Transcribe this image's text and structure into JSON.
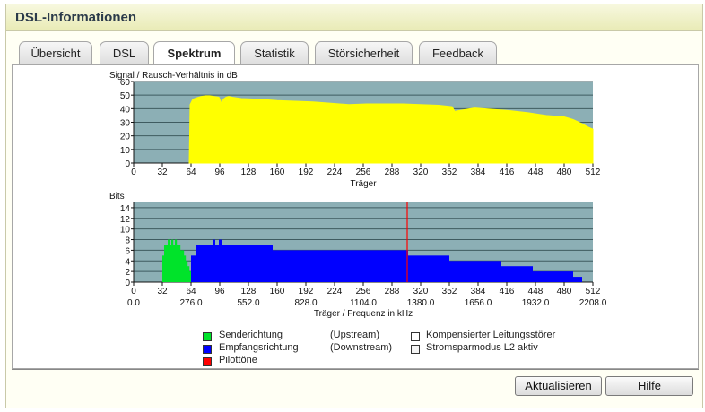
{
  "window": {
    "title": "DSL-Informationen"
  },
  "tabs": [
    {
      "label": "Übersicht",
      "active": false
    },
    {
      "label": "DSL",
      "active": false
    },
    {
      "label": "Spektrum",
      "active": true
    },
    {
      "label": "Statistik",
      "active": false
    },
    {
      "label": "Störsicherheit",
      "active": false
    },
    {
      "label": "Feedback",
      "active": false
    }
  ],
  "colors": {
    "plot_bg": "#8cafb5",
    "snr": "#ffff00",
    "upstream": "#00e32a",
    "downstream": "#0000ff",
    "pilot": "#ff0000"
  },
  "chart_data": [
    {
      "type": "area",
      "title": "Signal / Rausch-Verhältnis in dB",
      "xlabel": "Träger",
      "ylabel": "",
      "xlim": [
        0,
        512
      ],
      "ylim": [
        0,
        60
      ],
      "xticks": [
        0,
        32,
        64,
        96,
        128,
        160,
        192,
        224,
        256,
        288,
        320,
        352,
        384,
        416,
        448,
        480,
        512
      ],
      "yticks": [
        0,
        10,
        20,
        30,
        40,
        50,
        60
      ],
      "grid": true,
      "series": [
        {
          "x": [
            62,
            63,
            66,
            70,
            75,
            80,
            85,
            90,
            95,
            98,
            100,
            103,
            106,
            110,
            120,
            140,
            160,
            200,
            220,
            240,
            260,
            280,
            300,
            320,
            340,
            355,
            358,
            380,
            400,
            420,
            440,
            460,
            480,
            490,
            500,
            505,
            510,
            512
          ],
          "values": [
            0,
            43,
            47,
            48,
            49,
            49.5,
            49.5,
            49,
            48.5,
            44,
            47,
            48.5,
            49,
            48.5,
            47.5,
            47,
            46,
            45,
            44,
            43,
            43.5,
            43.5,
            43.5,
            43,
            42.5,
            41.5,
            38,
            40.5,
            39.5,
            38.5,
            37,
            35,
            34,
            32,
            29,
            27,
            25.5,
            25
          ]
        }
      ]
    },
    {
      "type": "bar",
      "title": "Bits",
      "xlabel": "Träger / Frequenz in kHz",
      "ylabel": "",
      "xlim": [
        0,
        512
      ],
      "ylim": [
        0,
        15
      ],
      "xticks": [
        0,
        32,
        64,
        96,
        128,
        160,
        192,
        224,
        256,
        288,
        320,
        352,
        384,
        416,
        448,
        480,
        512
      ],
      "yticks": [
        0,
        2,
        4,
        6,
        8,
        10,
        12,
        14
      ],
      "freq_ticks": [
        "0.0",
        "276.0",
        "552.0",
        "828.0",
        "1104.0",
        "1380.0",
        "1656.0",
        "1932.0",
        "2208.0"
      ],
      "grid": true,
      "series": [
        {
          "name": "Senderichtung",
          "x": [
            33,
            35,
            37,
            39,
            41,
            43,
            45,
            47,
            49,
            51,
            53,
            55,
            57,
            59,
            61,
            63
          ],
          "values": [
            5,
            7,
            7,
            8,
            7,
            8,
            7,
            8,
            7,
            7,
            6,
            6,
            5,
            4,
            3,
            2
          ]
        },
        {
          "name": "Empfangsrichtung",
          "segments": [
            [
              64,
              69,
              5
            ],
            [
              69,
              75,
              7
            ],
            [
              75,
              88,
              7
            ],
            [
              88,
              91,
              8
            ],
            [
              91,
              95,
              7
            ],
            [
              95,
              98,
              8
            ],
            [
              98,
              150,
              7
            ],
            [
              150,
              155,
              7
            ],
            [
              155,
              160,
              6
            ],
            [
              160,
              185,
              6
            ],
            [
              185,
              240,
              6
            ],
            [
              240,
              290,
              6
            ],
            [
              290,
              306,
              6
            ],
            [
              306,
              345,
              5
            ],
            [
              345,
              352,
              5
            ],
            [
              352,
              385,
              4
            ],
            [
              385,
              410,
              4
            ],
            [
              410,
              415,
              3
            ],
            [
              415,
              445,
              3
            ],
            [
              445,
              450,
              2
            ],
            [
              450,
              490,
              2
            ],
            [
              490,
              494,
              1
            ],
            [
              494,
              500,
              1
            ]
          ]
        },
        {
          "name": "Pilottöne",
          "x": [
            305
          ],
          "values": [
            15
          ]
        }
      ]
    }
  ],
  "legend": {
    "upstream_label": "Senderichtung",
    "upstream_dir": "(Upstream)",
    "downstream_label": "Empfangsrichtung",
    "downstream_dir": "(Downstream)",
    "pilot_label": "Pilottöne",
    "comp_label": "Kompensierter Leitungsstörer",
    "l2_label": "Stromsparmodus L2 aktiv"
  },
  "buttons": {
    "refresh": "Aktualisieren",
    "help": "Hilfe"
  }
}
